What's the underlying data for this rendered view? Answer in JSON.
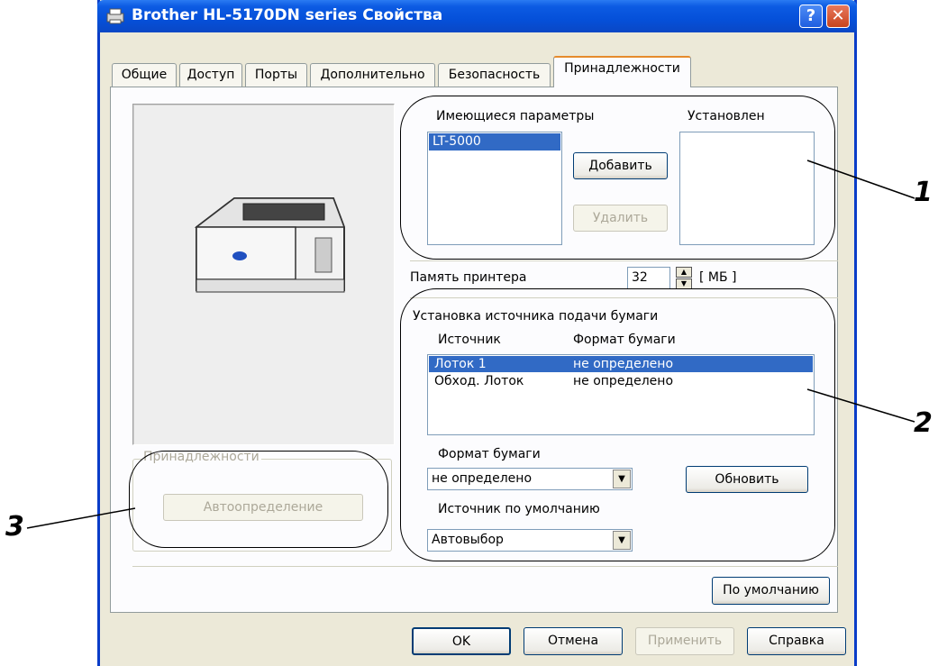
{
  "window": {
    "title": "Brother HL-5170DN series Свойства",
    "help_button": "?",
    "close_button": "✕"
  },
  "tabs": [
    {
      "label": "Общие"
    },
    {
      "label": "Доступ"
    },
    {
      "label": "Порты"
    },
    {
      "label": "Дополнительно"
    },
    {
      "label": "Безопасность"
    },
    {
      "label": "Принадлежности",
      "active": true
    }
  ],
  "options": {
    "available_label": "Имеющиеся параметры",
    "installed_label": "Установлен",
    "available_items": [
      "LT-5000"
    ],
    "add_button": "Добавить",
    "remove_button": "Удалить"
  },
  "memory": {
    "label": "Память принтера",
    "value": "32",
    "unit": "[ МБ ]"
  },
  "paper_source": {
    "group_label": "Установка источника подачи бумаги",
    "col_source": "Источник",
    "col_format": "Формат бумаги",
    "rows": [
      {
        "source": "Лоток  1",
        "format": "не определено",
        "selected": true
      },
      {
        "source": "Обход. Лоток",
        "format": "не определено",
        "selected": false
      }
    ],
    "format_label": "Формат бумаги",
    "format_value": "не определено",
    "update_button": "Обновить",
    "default_source_label": "Источник по умолчанию",
    "default_source_value": "Автовыбор"
  },
  "accessories": {
    "group_label": "Принадлежности",
    "autodetect_button": "Автоопределение"
  },
  "defaults_button": "По умолчанию",
  "footer": {
    "ok": "OK",
    "cancel": "Отмена",
    "apply": "Применить",
    "help": "Справка"
  },
  "callouts": [
    "1",
    "2",
    "3"
  ]
}
